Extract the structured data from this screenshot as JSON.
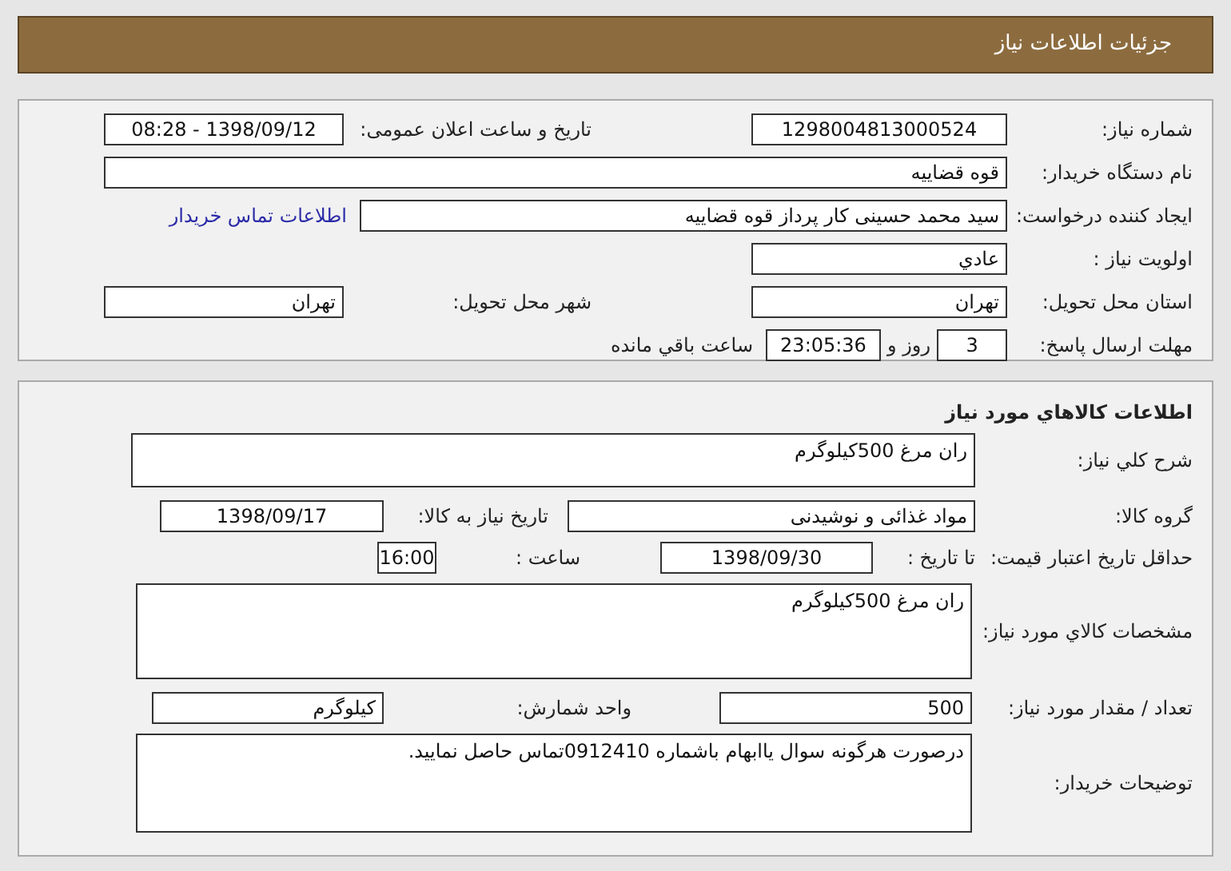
{
  "header": {
    "title": "جزئیات اطلاعات نیاز"
  },
  "need_info": {
    "need_number_label": "شماره نیاز:",
    "need_number": "1298004813000524",
    "announce_label": "تاریخ و ساعت اعلان عمومی:",
    "announce_value": "1398/09/12 - 08:28",
    "buyer_label": "نام دستگاه خریدار:",
    "buyer": "قوه قضاییه",
    "creator_label": "ایجاد کننده درخواست:",
    "creator": "سید محمد حسینی کار پرداز  قوه قضاییه",
    "contact_link": "اطلاعات تماس خریدار",
    "priority_label": "اولویت نیاز :",
    "priority": "عادي",
    "province_label": "استان محل تحویل:",
    "province": "تهران",
    "city_label": "شهر محل تحویل:",
    "city": "تهران",
    "deadline_label": "مهلت ارسال پاسخ:",
    "days": "3",
    "days_text": "روز و",
    "time_left": "23:05:36",
    "time_left_text": "ساعت باقي مانده"
  },
  "goods": {
    "title": "اطلاعات کالاهاي مورد نياز",
    "summary_label": "شرح کلي نياز:",
    "summary": "ران مرغ 500کیلوگرم",
    "group_label": "گروه کالا:",
    "group": "مواد غذائی و نوشیدنی",
    "need_date_label": "تاریخ نیاز به کالا:",
    "need_date": "1398/09/17",
    "validity_label": "حداقل تاریخ اعتبار قیمت:",
    "until_label": "تا تاریخ :",
    "until_date": "1398/09/30",
    "hour_label": "ساعت :",
    "hour": "16:00",
    "spec_label": "مشخصات کالاي مورد نياز:",
    "spec": "ران مرغ 500کیلوگرم",
    "qty_label": "تعداد / مقدار مورد نیاز:",
    "qty": "500",
    "unit_label": "واحد شمارش:",
    "unit": "کیلوگرم",
    "notes_label": "توضیحات خریدار:",
    "notes": "درصورت هرگونه سوال یاابهام باشماره 0912410تماس حاصل نمایید."
  }
}
